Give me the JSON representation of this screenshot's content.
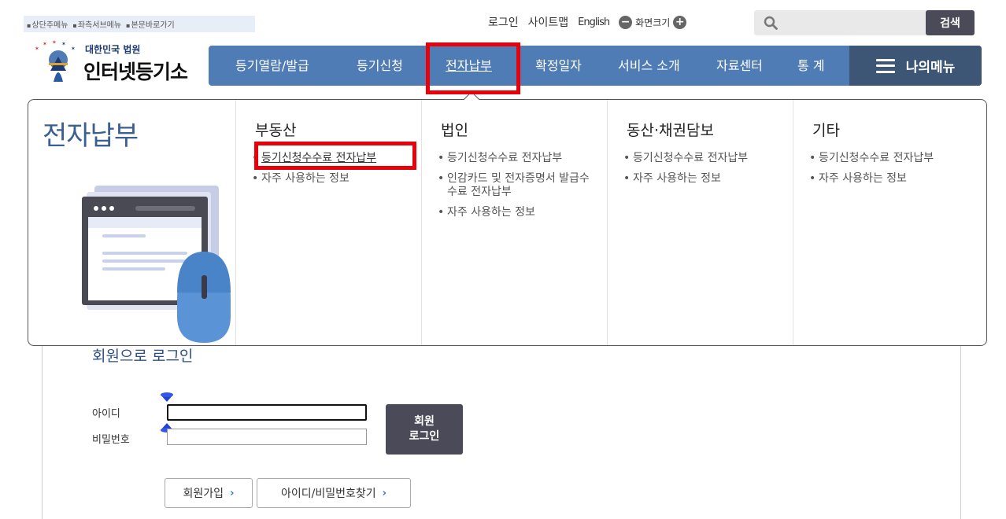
{
  "skipnav": [
    "상단주메뉴",
    "좌측서브메뉴",
    "본문바로가기"
  ],
  "util": {
    "login": "로그인",
    "sitemap": "사이트맵",
    "english": "English",
    "zoom_label": "화면크기",
    "zoom_minus": "−",
    "zoom_plus": "+"
  },
  "search": {
    "placeholder": "",
    "button": "검색"
  },
  "logo": {
    "sub": "대한민국 법원",
    "main": "인터넷등기소"
  },
  "gnb": {
    "items": [
      "등기열람/발급",
      "등기신청",
      "전자납부",
      "확정일자",
      "서비스 소개",
      "자료센터",
      "통 계"
    ],
    "mymenu": "나의메뉴"
  },
  "mega": {
    "title": "전자납부",
    "columns": [
      {
        "heading": "부동산",
        "items": [
          "등기신청수수료 전자납부",
          "자주 사용하는 정보"
        ]
      },
      {
        "heading": "법인",
        "items": [
          "등기신청수수료 전자납부",
          "인감카드 및 전자증명서 발급수수료 전자납부",
          "자주 사용하는 정보"
        ]
      },
      {
        "heading": "동산·채권담보",
        "items": [
          "등기신청수수료 전자납부",
          "자주 사용하는 정보"
        ]
      },
      {
        "heading": "기타",
        "items": [
          "등기신청수수료 전자납부",
          "자주 사용하는 정보"
        ]
      }
    ]
  },
  "login": {
    "title": "회원으로 로그인",
    "id_label": "아이디",
    "pw_label": "비밀번호",
    "id_value": "",
    "pw_value": "",
    "button_line1": "회원",
    "button_line2": "로그인",
    "join": "회원가입",
    "find": "아이디/비밀번호찾기"
  },
  "colors": {
    "gnb": "#4f7cb5",
    "mymenu": "#3d5676",
    "highlight": "#e8000b",
    "title": "#3b5f95"
  }
}
